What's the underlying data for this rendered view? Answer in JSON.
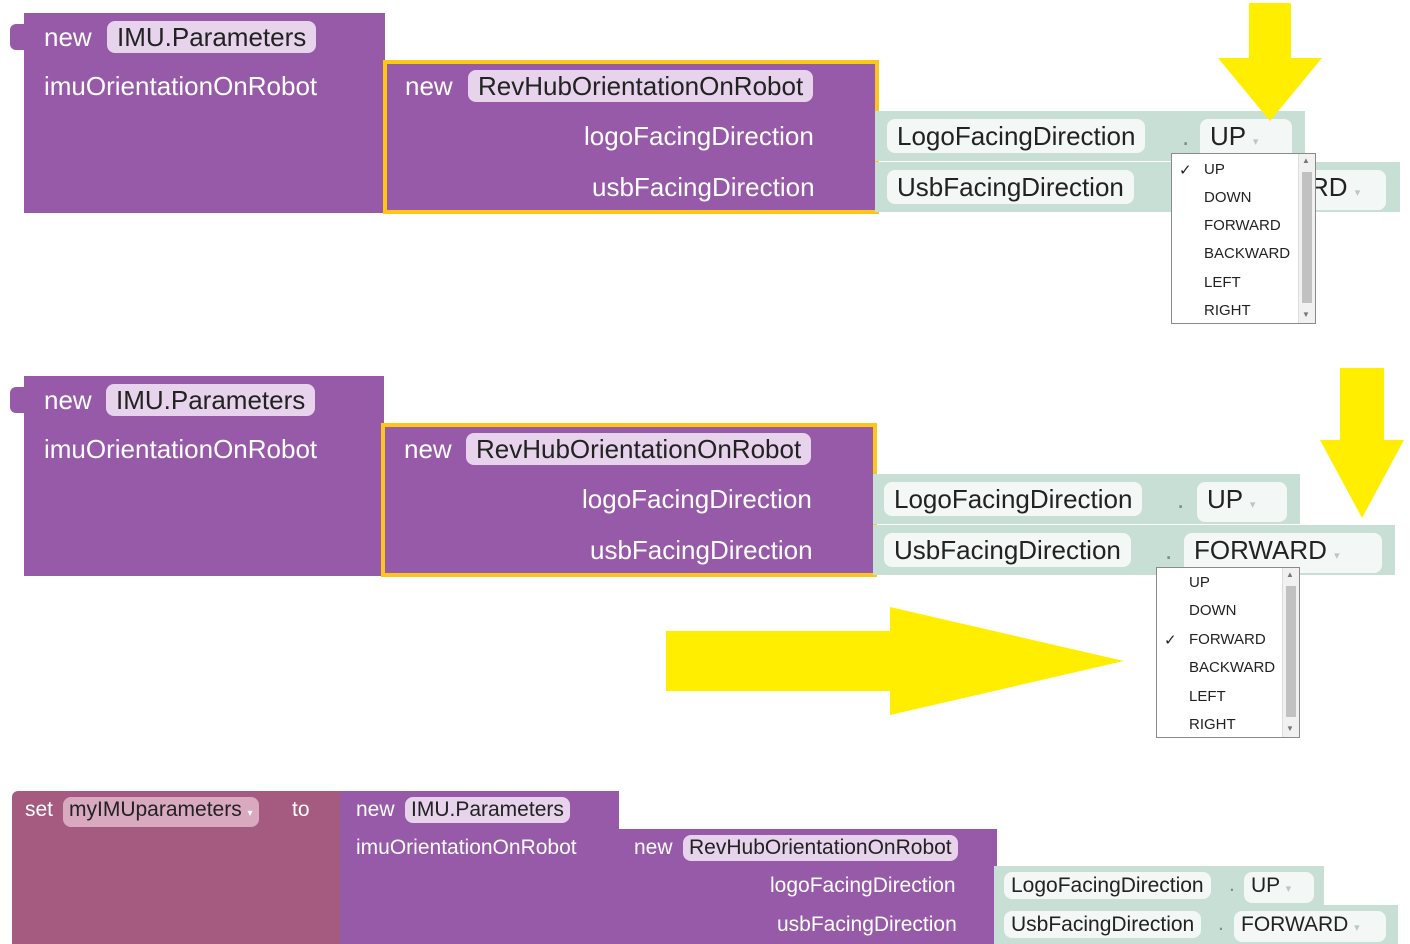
{
  "accent": {
    "block_purple": "#975aa8",
    "block_teal": "#c7dfd4",
    "highlight_yellow": "#ffc61a",
    "arrow_yellow": "#ffee00",
    "set_maroon": "#a55b80"
  },
  "panel1": {
    "new": "new",
    "imu_params": "IMU.Parameters",
    "imu_orientation_label": "imuOrientationOnRobot",
    "rev_new": "new",
    "rev_class": "RevHubOrientationOnRobot",
    "logo_label": "logoFacingDirection",
    "usb_label": "usbFacingDirection",
    "logo_enum": "LogoFacingDirection",
    "logo_dot": ".",
    "logo_value": "UP",
    "usb_enum": "UsbFacingDirection",
    "usb_value_partial": "RD",
    "dropdown": {
      "options": [
        "UP",
        "DOWN",
        "FORWARD",
        "BACKWARD",
        "LEFT",
        "RIGHT"
      ],
      "selected": "UP",
      "check": "✓"
    }
  },
  "panel2": {
    "new": "new",
    "imu_params": "IMU.Parameters",
    "imu_orientation_label": "imuOrientationOnRobot",
    "rev_new": "new",
    "rev_class": "RevHubOrientationOnRobot",
    "logo_label": "logoFacingDirection",
    "usb_label": "usbFacingDirection",
    "logo_enum": "LogoFacingDirection",
    "logo_dot": ".",
    "logo_value": "UP",
    "usb_enum": "UsbFacingDirection",
    "usb_dot": ".",
    "usb_value": "FORWARD",
    "dropdown": {
      "options": [
        "UP",
        "DOWN",
        "FORWARD",
        "BACKWARD",
        "LEFT",
        "RIGHT"
      ],
      "selected": "FORWARD",
      "check": "✓"
    }
  },
  "panel3": {
    "set": "set",
    "variable": "myIMUparameters",
    "to": "to",
    "new": "new",
    "imu_params": "IMU.Parameters",
    "imu_orientation_label": "imuOrientationOnRobot",
    "rev_new": "new",
    "rev_class": "RevHubOrientationOnRobot",
    "logo_label": "logoFacingDirection",
    "usb_label": "usbFacingDirection",
    "logo_enum": "LogoFacingDirection",
    "logo_dot": ".",
    "logo_value": "UP",
    "usb_enum": "UsbFacingDirection",
    "usb_dot": ".",
    "usb_value": "FORWARD"
  },
  "icons": {
    "dropdown_caret": "▾",
    "scroll_up": "▲",
    "scroll_down": "▼"
  }
}
